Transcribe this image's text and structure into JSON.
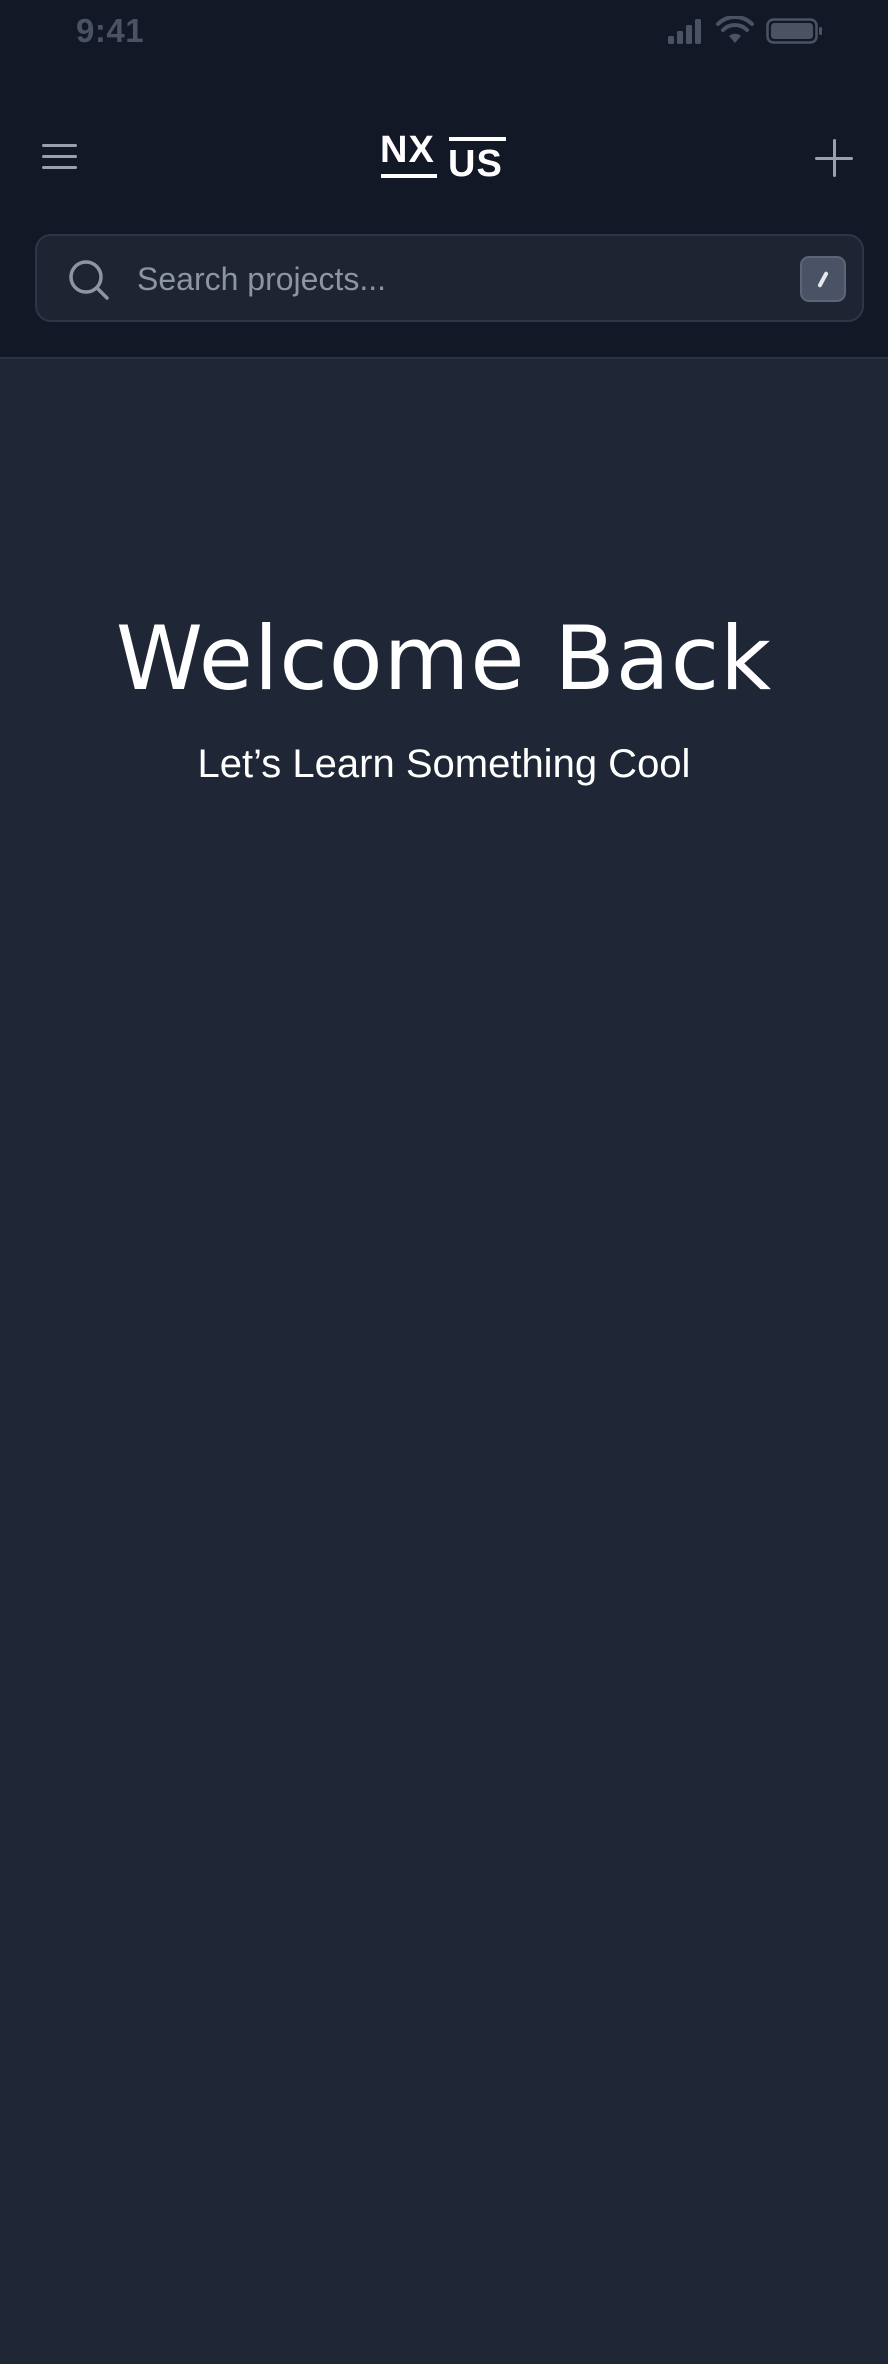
{
  "status_bar": {
    "time": "9:41",
    "icons": [
      "signal-icon",
      "wifi-icon",
      "battery-icon"
    ]
  },
  "header": {
    "menu_icon": "menu-icon",
    "logo": {
      "part1": "NX",
      "part2": "US"
    },
    "add_icon": "plus-icon"
  },
  "search": {
    "placeholder": "Search projects...",
    "value": "",
    "shortcut_key": "/"
  },
  "hero": {
    "title": "Welcome Back",
    "subtitle": "Let’s Learn Something Cool"
  },
  "colors": {
    "header_bg": "#121826",
    "body_bg": "#1f2736",
    "search_bg": "#1e2431",
    "muted_text": "#8e95a2"
  }
}
